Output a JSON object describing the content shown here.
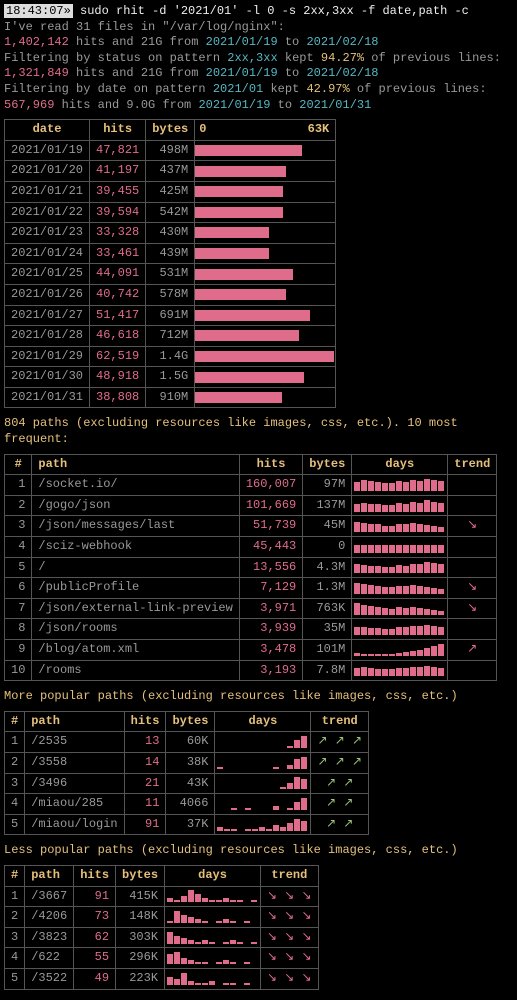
{
  "prompt": {
    "time": "18:43:07»",
    "command": "sudo rhit -d '2021/01' -l 0 -s 2xx,3xx -f date,path -c"
  },
  "summary": {
    "read_files": "I've read 31 files in \"/var/log/nginx\":",
    "line1_hits": "1,402,142",
    "line1_text": " hits and 21G from ",
    "line1_from": "2021/01/19",
    "line1_to_text": " to ",
    "line1_to": "2021/02/18",
    "filter_status": "Filtering by status on pattern ",
    "filter_status_pattern": "2xx,3xx",
    "filter_status_kept": " kept ",
    "filter_status_pct": "94.27%",
    "filter_status_suffix": " of previous lines:",
    "line2_hits": "1,321,849",
    "filter_date": "Filtering by date on pattern ",
    "filter_date_pattern": "2021/01",
    "filter_date_pct": "42.97%",
    "line3_hits": "567,969",
    "line3_text": " hits and 9.0G from ",
    "line3_from": "2021/01/19",
    "line3_to": "2021/01/31"
  },
  "dates_table": {
    "headers": {
      "date": "date",
      "hits": "hits",
      "bytes": "bytes",
      "hist_lo": "0",
      "hist_hi": "63K"
    },
    "rows": [
      {
        "date": "2021/01/19",
        "hits": "47,821",
        "bytes": "498M",
        "bar": 76
      },
      {
        "date": "2021/01/20",
        "hits": "41,197",
        "bytes": "437M",
        "bar": 65
      },
      {
        "date": "2021/01/21",
        "hits": "39,455",
        "bytes": "425M",
        "bar": 63
      },
      {
        "date": "2021/01/22",
        "hits": "39,594",
        "bytes": "542M",
        "bar": 63
      },
      {
        "date": "2021/01/23",
        "hits": "33,328",
        "bytes": "430M",
        "bar": 53
      },
      {
        "date": "2021/01/24",
        "hits": "33,461",
        "bytes": "439M",
        "bar": 53
      },
      {
        "date": "2021/01/25",
        "hits": "44,091",
        "bytes": "531M",
        "bar": 70
      },
      {
        "date": "2021/01/26",
        "hits": "40,742",
        "bytes": "578M",
        "bar": 65
      },
      {
        "date": "2021/01/27",
        "hits": "51,417",
        "bytes": "691M",
        "bar": 82
      },
      {
        "date": "2021/01/28",
        "hits": "46,618",
        "bytes": "712M",
        "bar": 74
      },
      {
        "date": "2021/01/29",
        "hits": "62,519",
        "bytes": "1.4G",
        "bar": 99
      },
      {
        "date": "2021/01/30",
        "hits": "48,918",
        "bytes": "1.5G",
        "bar": 78
      },
      {
        "date": "2021/01/31",
        "hits": "38,808",
        "bytes": "910M",
        "bar": 62
      }
    ]
  },
  "paths_section": "804 paths (excluding resources like images, css, etc.). 10 most frequent:",
  "paths_table": {
    "headers": {
      "n": "#",
      "path": "path",
      "hits": "hits",
      "bytes": "bytes",
      "days": "days",
      "trend": "trend"
    },
    "rows": [
      {
        "n": "1",
        "path": "/socket.io/",
        "hits": "160,007",
        "bytes": "97M",
        "spark": [
          9,
          11,
          10,
          9,
          8,
          8,
          10,
          9,
          11,
          10,
          12,
          11,
          10
        ],
        "trend": ""
      },
      {
        "n": "2",
        "path": "/gogo/json",
        "hits": "101,669",
        "bytes": "137M",
        "spark": [
          8,
          9,
          8,
          8,
          7,
          7,
          9,
          8,
          10,
          9,
          12,
          10,
          9
        ],
        "trend": ""
      },
      {
        "n": "3",
        "path": "/json/messages/last",
        "hits": "51,739",
        "bytes": "45M",
        "spark": [
          10,
          9,
          8,
          8,
          6,
          6,
          8,
          8,
          9,
          8,
          7,
          6,
          5
        ],
        "trend": "↘"
      },
      {
        "n": "4",
        "path": "/sciz-webhook",
        "hits": "45,443",
        "bytes": "0",
        "spark": [
          8,
          8,
          8,
          8,
          8,
          8,
          8,
          8,
          8,
          8,
          8,
          8,
          8
        ],
        "trend": ""
      },
      {
        "n": "5",
        "path": "/",
        "hits": "13,556",
        "bytes": "4.3M",
        "spark": [
          9,
          8,
          7,
          7,
          6,
          6,
          8,
          7,
          9,
          9,
          11,
          10,
          9
        ],
        "trend": ""
      },
      {
        "n": "6",
        "path": "/publicProfile",
        "hits": "7,129",
        "bytes": "1.3M",
        "spark": [
          11,
          10,
          9,
          8,
          7,
          7,
          8,
          8,
          9,
          8,
          7,
          6,
          5
        ],
        "trend": "↘"
      },
      {
        "n": "7",
        "path": "/json/external-link-preview",
        "hits": "3,971",
        "bytes": "763K",
        "spark": [
          12,
          10,
          9,
          8,
          7,
          6,
          8,
          7,
          8,
          7,
          6,
          5,
          4
        ],
        "trend": "↘"
      },
      {
        "n": "8",
        "path": "/json/rooms",
        "hits": "3,939",
        "bytes": "35M",
        "spark": [
          8,
          8,
          7,
          7,
          6,
          6,
          8,
          8,
          9,
          9,
          10,
          9,
          8
        ],
        "trend": ""
      },
      {
        "n": "9",
        "path": "/blog/atom.xml",
        "hits": "3,478",
        "bytes": "101M",
        "spark": [
          3,
          2,
          2,
          2,
          2,
          2,
          3,
          4,
          5,
          6,
          8,
          10,
          12
        ],
        "trend": "↗"
      },
      {
        "n": "10",
        "path": "/rooms",
        "hits": "3,193",
        "bytes": "7.8M",
        "spark": [
          8,
          9,
          8,
          7,
          7,
          7,
          8,
          8,
          9,
          9,
          10,
          9,
          8
        ],
        "trend": ""
      }
    ]
  },
  "more_section": "More popular paths (excluding resources like images, css, etc.)",
  "more_table": {
    "headers": {
      "n": "#",
      "path": "path",
      "hits": "hits",
      "bytes": "bytes",
      "days": "days",
      "trend": "trend"
    },
    "rows": [
      {
        "n": "1",
        "path": "/2535",
        "hits": "13",
        "bytes": "60K",
        "spark": [
          0,
          0,
          0,
          0,
          0,
          0,
          0,
          0,
          0,
          0,
          2,
          8,
          12
        ],
        "trend": "↗ ↗ ↗"
      },
      {
        "n": "2",
        "path": "/3558",
        "hits": "14",
        "bytes": "38K",
        "spark": [
          2,
          0,
          0,
          0,
          0,
          0,
          0,
          0,
          2,
          0,
          4,
          10,
          12
        ],
        "trend": "↗ ↗ ↗"
      },
      {
        "n": "3",
        "path": "/3496",
        "hits": "21",
        "bytes": "43K",
        "spark": [
          0,
          0,
          0,
          0,
          0,
          0,
          0,
          0,
          0,
          2,
          6,
          12,
          10
        ],
        "trend": "↗ ↗"
      },
      {
        "n": "4",
        "path": "/miaou/285",
        "hits": "11",
        "bytes": "4066",
        "spark": [
          0,
          0,
          2,
          0,
          2,
          0,
          0,
          0,
          4,
          0,
          2,
          8,
          12
        ],
        "trend": "↗ ↗"
      },
      {
        "n": "5",
        "path": "/miaou/login",
        "hits": "91",
        "bytes": "37K",
        "spark": [
          4,
          2,
          2,
          0,
          2,
          2,
          4,
          2,
          6,
          4,
          8,
          12,
          10
        ],
        "trend": "↗ ↗"
      }
    ]
  },
  "less_section": "Less popular paths (excluding resources like images, css, etc.)",
  "less_table": {
    "headers": {
      "n": "#",
      "path": "path",
      "hits": "hits",
      "bytes": "bytes",
      "days": "days",
      "trend": "trend"
    },
    "rows": [
      {
        "n": "1",
        "path": "/3667",
        "hits": "91",
        "bytes": "415K",
        "spark": [
          4,
          2,
          6,
          12,
          8,
          4,
          2,
          2,
          4,
          2,
          2,
          0,
          2
        ],
        "trend": "↘ ↘ ↘"
      },
      {
        "n": "2",
        "path": "/4206",
        "hits": "73",
        "bytes": "148K",
        "spark": [
          2,
          12,
          8,
          6,
          4,
          2,
          0,
          2,
          4,
          2,
          0,
          2,
          0
        ],
        "trend": "↘ ↘ ↘"
      },
      {
        "n": "3",
        "path": "/3823",
        "hits": "62",
        "bytes": "303K",
        "spark": [
          12,
          8,
          6,
          4,
          2,
          4,
          2,
          0,
          2,
          4,
          2,
          0,
          2
        ],
        "trend": "↘ ↘ ↘"
      },
      {
        "n": "4",
        "path": "/622",
        "hits": "55",
        "bytes": "296K",
        "spark": [
          10,
          12,
          6,
          4,
          2,
          2,
          0,
          2,
          4,
          2,
          0,
          2,
          0
        ],
        "trend": "↘ ↘ ↘"
      },
      {
        "n": "5",
        "path": "/3522",
        "hits": "49",
        "bytes": "223K",
        "spark": [
          8,
          6,
          12,
          4,
          2,
          2,
          4,
          0,
          2,
          2,
          0,
          2,
          0
        ],
        "trend": "↘ ↘ ↘"
      }
    ]
  },
  "chart_data": {
    "type": "bar",
    "title": "Hits by date",
    "xlabel": "date",
    "ylabel": "hits",
    "ylim": [
      0,
      63000
    ],
    "categories": [
      "2021/01/19",
      "2021/01/20",
      "2021/01/21",
      "2021/01/22",
      "2021/01/23",
      "2021/01/24",
      "2021/01/25",
      "2021/01/26",
      "2021/01/27",
      "2021/01/28",
      "2021/01/29",
      "2021/01/30",
      "2021/01/31"
    ],
    "values": [
      47821,
      41197,
      39455,
      39594,
      33328,
      33461,
      44091,
      40742,
      51417,
      46618,
      62519,
      48918,
      38808
    ]
  }
}
